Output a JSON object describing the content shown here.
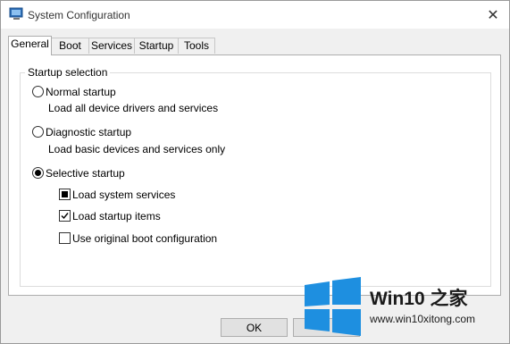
{
  "window": {
    "title": "System Configuration",
    "close_glyph": "✕"
  },
  "tabs": [
    {
      "label": "General",
      "active": true
    },
    {
      "label": "Boot"
    },
    {
      "label": "Services"
    },
    {
      "label": "Startup"
    },
    {
      "label": "Tools"
    }
  ],
  "startup_selection": {
    "legend": "Startup selection",
    "normal": {
      "label": "Normal startup",
      "desc": "Load all device drivers and services",
      "selected": false
    },
    "diagnostic": {
      "label": "Diagnostic startup",
      "desc": "Load basic devices and services only",
      "selected": false
    },
    "selective": {
      "label": "Selective startup",
      "selected": true
    },
    "options": {
      "load_system_services": {
        "label": "Load system services",
        "state": "indeterminate"
      },
      "load_startup_items": {
        "label": "Load startup items",
        "state": "checked"
      },
      "use_original_boot": {
        "label": "Use original boot configuration",
        "state": "unchecked"
      }
    }
  },
  "buttons": {
    "ok": "OK"
  },
  "watermark": {
    "title": "Win10 之家",
    "url": "www.win10xitong.com",
    "color": "#1e8fe0"
  }
}
